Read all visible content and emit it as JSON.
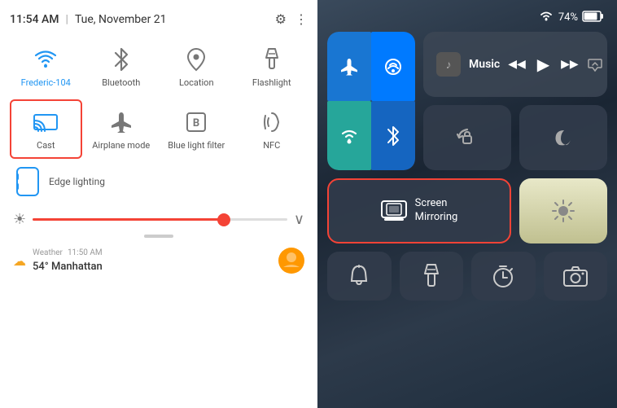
{
  "left": {
    "status": {
      "time": "11:54 AM",
      "divider": "|",
      "date": "Tue, November 21"
    },
    "tiles_row1": [
      {
        "id": "wifi",
        "label": "Frederic-104",
        "icon": "wifi",
        "active": true
      },
      {
        "id": "bluetooth",
        "label": "Bluetooth",
        "icon": "bluetooth",
        "active": false
      },
      {
        "id": "location",
        "label": "Location",
        "icon": "location",
        "active": false
      },
      {
        "id": "flashlight",
        "label": "Flashlight",
        "icon": "flashlight",
        "active": false
      }
    ],
    "tiles_row2": [
      {
        "id": "cast",
        "label": "Cast",
        "icon": "cast",
        "active": true,
        "highlighted": true
      },
      {
        "id": "airplane",
        "label": "Airplane mode",
        "icon": "airplane",
        "active": false
      },
      {
        "id": "bluelight",
        "label": "Blue light filter",
        "icon": "bluelight",
        "active": false
      },
      {
        "id": "nfc",
        "label": "NFC",
        "icon": "nfc",
        "active": false
      }
    ],
    "edge_lighting": {
      "label": "Edge lighting",
      "icon": "edge"
    },
    "brightness": {
      "value": 75,
      "icon": "☀"
    },
    "weather": {
      "label": "Weather",
      "time": "11:50 AM",
      "temp": "54° Manhattan"
    }
  },
  "right": {
    "status": {
      "wifi": "▴",
      "battery_pct": "74%"
    },
    "connectivity": [
      {
        "id": "airplane",
        "icon": "✈",
        "active": true,
        "color": "blue"
      },
      {
        "id": "airdrop",
        "icon": "📶",
        "active": true,
        "color": "blue2"
      },
      {
        "id": "wifi",
        "icon": "📶",
        "active": true,
        "color": "teal"
      },
      {
        "id": "bluetooth",
        "icon": "✱",
        "active": true,
        "color": "blue"
      }
    ],
    "music": {
      "label": "Music",
      "prev": "◀◀",
      "play": "▶",
      "next": "▶▶"
    },
    "lock_label": "🔒",
    "moon_label": "🌙",
    "screen_mirroring": {
      "label": "Screen\nMirroring",
      "icon": "▭"
    },
    "brightness_icon": "☀",
    "bottom": [
      {
        "id": "bell",
        "icon": "🔔"
      },
      {
        "id": "flashlight2",
        "icon": "🔦"
      },
      {
        "id": "timer",
        "icon": "⏱"
      },
      {
        "id": "camera",
        "icon": "📷"
      }
    ]
  }
}
